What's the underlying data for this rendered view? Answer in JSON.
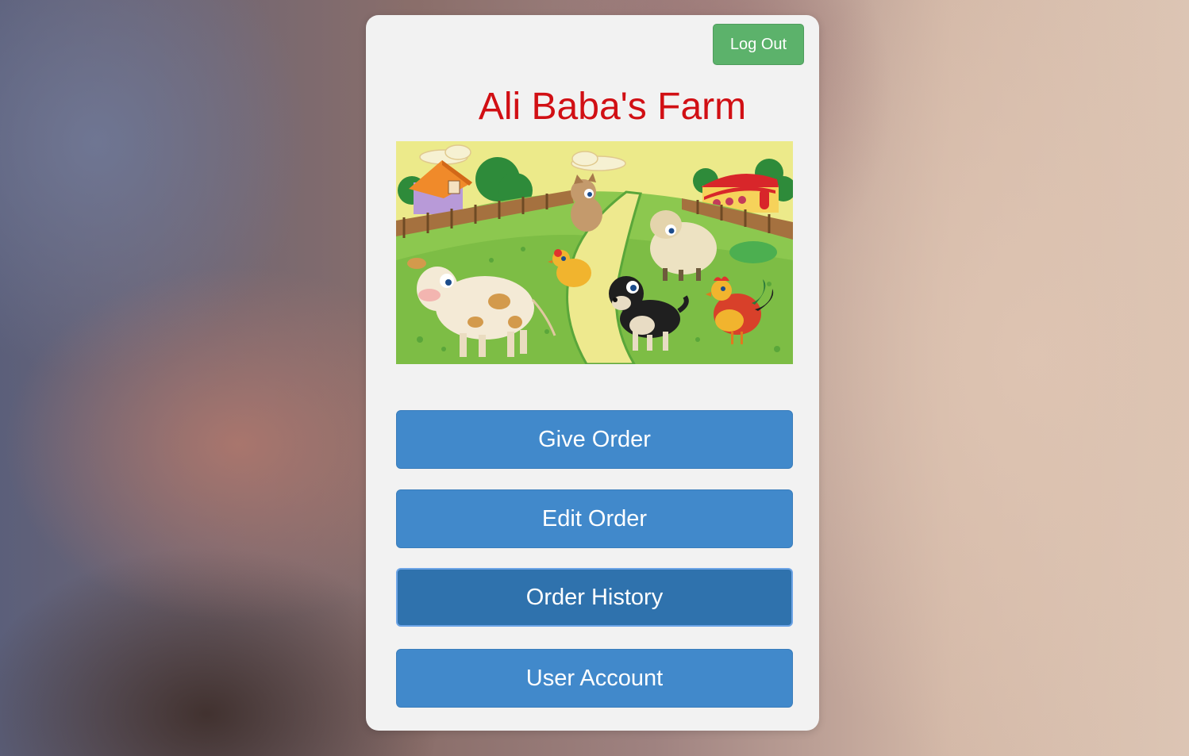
{
  "header": {
    "logout_label": "Log Out"
  },
  "main": {
    "title": "Ali Baba's Farm",
    "banner_alt": "farm-animals-illustration",
    "buttons": [
      {
        "label": "Give Order",
        "active": false
      },
      {
        "label": "Edit Order",
        "active": false
      },
      {
        "label": "Order History",
        "active": true
      },
      {
        "label": "User Account",
        "active": false
      }
    ]
  },
  "colors": {
    "title": "#d10f14",
    "primary_button": "#4189cb",
    "active_button": "#2f72ad",
    "logout_button": "#5cb26b",
    "card_background": "#f2f2f2"
  }
}
